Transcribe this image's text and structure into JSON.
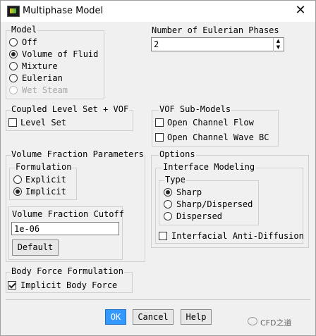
{
  "window": {
    "title": "Multiphase Model",
    "close_glyph": "✕"
  },
  "model": {
    "label": "Model",
    "options": [
      {
        "label": "Off",
        "selected": false,
        "disabled": false
      },
      {
        "label": "Volume of Fluid",
        "selected": true,
        "disabled": false
      },
      {
        "label": "Mixture",
        "selected": false,
        "disabled": false
      },
      {
        "label": "Eulerian",
        "selected": false,
        "disabled": false
      },
      {
        "label": "Wet Steam",
        "selected": false,
        "disabled": true
      }
    ]
  },
  "eulerian_phases": {
    "label": "Number of Eulerian Phases",
    "value": "2"
  },
  "coupled": {
    "label": "Coupled Level Set + VOF",
    "level_set": {
      "label": "Level Set",
      "checked": false
    }
  },
  "vof_sub": {
    "label": "VOF Sub-Models",
    "open_channel_flow": {
      "label": "Open Channel Flow",
      "checked": false
    },
    "open_channel_wave": {
      "label": "Open Channel Wave BC",
      "checked": false
    }
  },
  "vf_params": {
    "label": "Volume Fraction Parameters",
    "formulation": {
      "label": "Formulation",
      "explicit": {
        "label": "Explicit",
        "selected": false
      },
      "implicit": {
        "label": "Implicit",
        "selected": true
      }
    },
    "cutoff": {
      "label": "Volume Fraction Cutoff",
      "value": "1e-06",
      "default_label": "Default"
    }
  },
  "options": {
    "label": "Options",
    "interface_modeling": {
      "label": "Interface Modeling",
      "type": {
        "label": "Type",
        "sharp": {
          "label": "Sharp",
          "selected": true
        },
        "sharp_dispersed": {
          "label": "Sharp/Dispersed",
          "selected": false
        },
        "dispersed": {
          "label": "Dispersed",
          "selected": false
        }
      },
      "anti_diffusion": {
        "label": "Interfacial Anti-Diffusion",
        "checked": false
      }
    }
  },
  "body_force": {
    "label": "Body Force Formulation",
    "implicit": {
      "label": "Implicit Body Force",
      "checked": true
    }
  },
  "buttons": {
    "ok": "OK",
    "cancel": "Cancel",
    "help": "Help"
  },
  "watermark": {
    "text": "CFD之道"
  }
}
